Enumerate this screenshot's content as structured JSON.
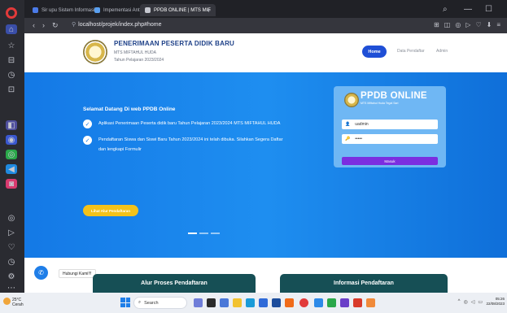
{
  "browser": {
    "tabs": [
      {
        "label": "Sir upu Sistem Informasi ...",
        "active": false,
        "color": "#4b7be8"
      },
      {
        "label": "Impementasi Antar muk...",
        "active": false,
        "color": "#5aa0f0"
      },
      {
        "label": "PPDB ONLINE | MTS MIF",
        "active": true,
        "color": "#9aa0ad"
      }
    ],
    "new_tab": "+",
    "url": "localhost/projek/index.php#home"
  },
  "site": {
    "title": "PENERIMAAN PESERTA DIDIK BARU",
    "school": "MTS MIFTAHUL HUDA",
    "year": "Tahun Pelajaran 2023/2024",
    "nav": {
      "home": "Home",
      "data": "Data Pendaftar",
      "admin": "Admin"
    }
  },
  "hero": {
    "welcome": "Selamat Datang Di web PPDB Online",
    "line1": "Aplikasi Penerimaan Peserta didik baru Tahun Pelajaran 2023/2024 MTS MIFTAHUL HUDA",
    "line2a": "Pendaftaran Siswa dan Siswi Baru Tahun 2023/2024 ini telah dibuka. Silahkan Segera Daftar",
    "line2b": "dan lengkapi Formulir",
    "cta": "Lihat Alur Pendaftaran"
  },
  "login": {
    "title": "PPDB ONLINE",
    "subtitle": "MTS Miftahul Huda Tegal Sari",
    "username": "uadmin",
    "password": "•••••",
    "submit": "Masuk"
  },
  "sections": {
    "alur": "Alur Proses Pendaftaran",
    "info": "Informasi Pendaftaran"
  },
  "chat": {
    "label": "Hubungi Kami!!!"
  },
  "taskbar": {
    "temp": "25°C",
    "weather": "Cerah",
    "search": "Search",
    "time": "05:26",
    "date": "22/08/2023"
  },
  "colors": {
    "hero": "#1479e6",
    "primary": "#1f4fd6",
    "cta": "#f4c21a",
    "login_btn": "#7b2ee0",
    "section": "#164f55"
  }
}
